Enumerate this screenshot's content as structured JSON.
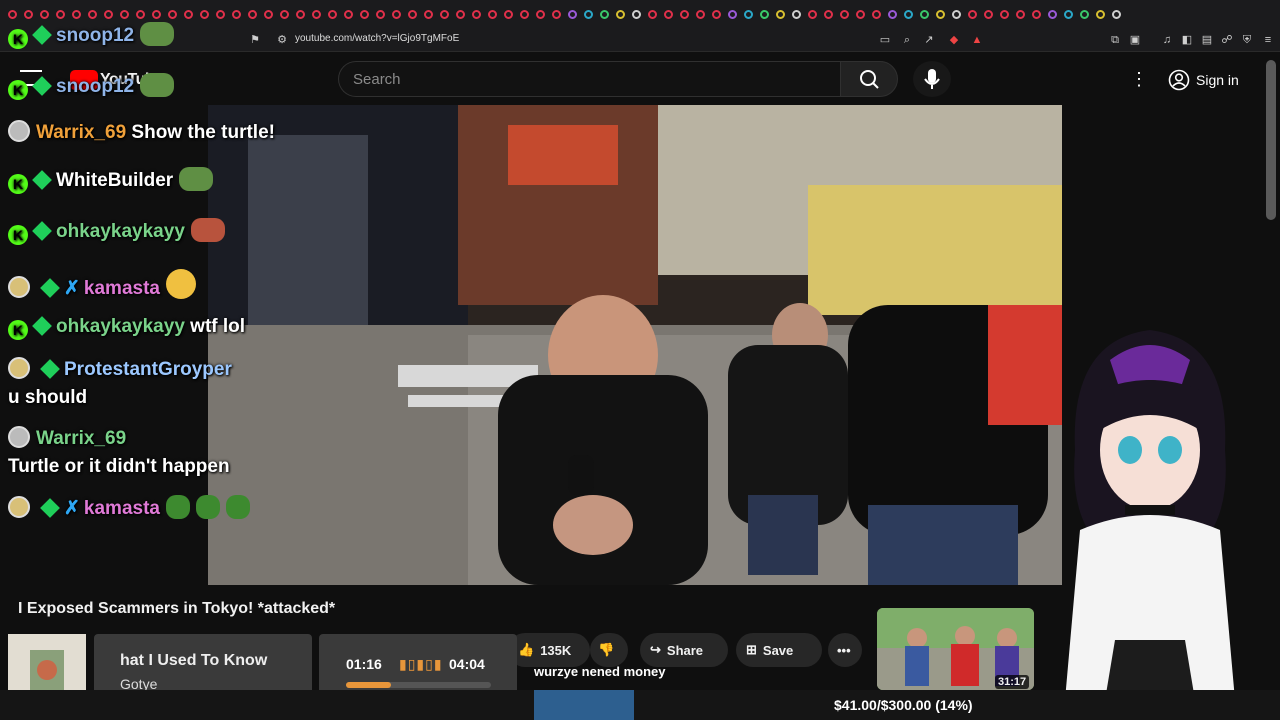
{
  "browser": {
    "url": "youtube.com/watch?v=lGjo9TgMFoE",
    "tab_count_icons": 70
  },
  "youtube": {
    "logo_text": "YouTube",
    "search_placeholder": "Search",
    "sign_in_label": "Sign in"
  },
  "chat": {
    "messages": [
      {
        "user": "snoop12",
        "text": "",
        "user_color": "#8fb4e8"
      },
      {
        "user": "snoop12",
        "text": "",
        "user_color": "#8fb4e8"
      },
      {
        "user": "Warrix_69",
        "text": "Show the turtle!",
        "user_color": "#f0a13a"
      },
      {
        "user": "WhiteBuilder",
        "text": "",
        "user_color": "#ffffff"
      },
      {
        "user": "ohkaykaykayy",
        "text": "",
        "user_color": "#7ad38a"
      },
      {
        "user": "kamasta",
        "text": "",
        "user_color": "#e07ad7"
      },
      {
        "user": "ohkaykaykayy",
        "text": "wtf lol",
        "user_color": "#7ad38a"
      },
      {
        "user": "ProtestantGroyper",
        "text": "u should",
        "user_color": "#9cc8ff"
      },
      {
        "user": "Warrix_69",
        "text": "Turtle or it didn't happen",
        "user_color": "#7ad38a"
      },
      {
        "user": "kamasta",
        "text": "",
        "user_color": "#e07ad7"
      }
    ]
  },
  "video": {
    "title": "I Exposed Scammers in Tokyo! *attacked*",
    "like_count": "135K",
    "share_label": "Share",
    "save_label": "Save",
    "caption_overlay": "wurzye nened money"
  },
  "music": {
    "track_title": "hat I Used To Know",
    "artist": "Gotye",
    "elapsed": "01:16",
    "total": "04:04",
    "progress": 0.31
  },
  "recommended": {
    "duration": "31:17"
  },
  "donation_goal": {
    "text": "$41.00/$300.00 (14%)",
    "progress": 0.14
  },
  "colors": {
    "accent_kick": "#53fc18",
    "music_progress": "#e8963a"
  }
}
